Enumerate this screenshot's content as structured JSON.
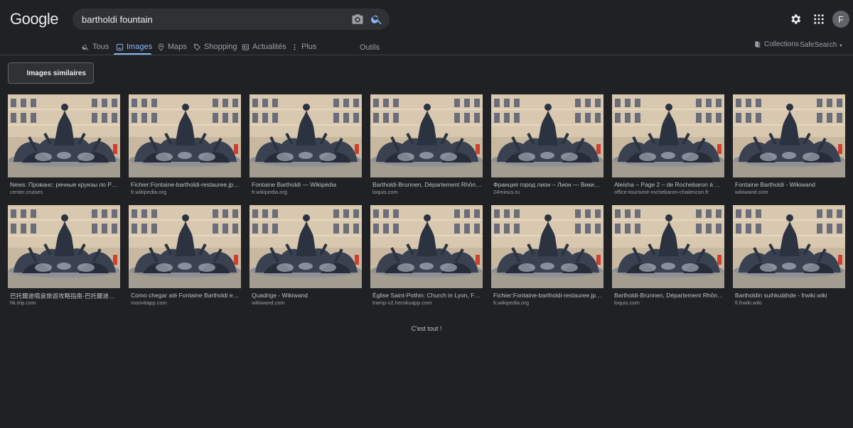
{
  "logo": {
    "text": "Google",
    "letters": [
      "G",
      "o",
      "o",
      "g",
      "l",
      "e"
    ],
    "colors": [
      "#8ab4f8",
      "#f28b82",
      "#fdd663",
      "#8ab4f8",
      "#81c995",
      "#f28b82"
    ]
  },
  "search": {
    "query": "bartholdi fountain",
    "placeholder": ""
  },
  "header": {
    "avatar_letter": "F",
    "gear": "gear-icon",
    "apps": "apps-grid-icon"
  },
  "tabs": [
    {
      "label": "Tous",
      "icon": "search-icon"
    },
    {
      "label": "Images",
      "icon": "image-icon",
      "active": true
    },
    {
      "label": "Maps",
      "icon": "map-pin-icon"
    },
    {
      "label": "Shopping",
      "icon": "tag-icon"
    },
    {
      "label": "Actualités",
      "icon": "news-icon"
    },
    {
      "label": "Plus",
      "icon": "more-vert-icon"
    },
    {
      "label": "Outils",
      "icon": ""
    }
  ],
  "right_links": {
    "collections": "Collections",
    "safesearch": "SafeSearch"
  },
  "similar_button": "Images similaires",
  "results": [
    {
      "title": "News: Прованс: речные круизы по Рон…",
      "source": "center.cruises"
    },
    {
      "title": "Fichier:Fontaine-bartholdi-restauree.jpg …",
      "source": "fr.wikipedia.org"
    },
    {
      "title": "Fontaine Bartholdi — Wikipédia",
      "source": "fr.wikipedia.org"
    },
    {
      "title": "Bartholdi-Brunnen, Département Rhône P…",
      "source": "loquis.com"
    },
    {
      "title": "Франция город лион – Лион — Википе…",
      "source": "24minus.ru"
    },
    {
      "title": "Aleisha – Page 2 – de Rochebaron à Cha…",
      "source": "office-tourisme-rochebaron-chalencon.fr"
    },
    {
      "title": "Fontaine Bartholdi - Wikiwand",
      "source": "wikiwand.com"
    },
    {
      "title": "巴托爾迪噴泉旅遊攻略指南-巴托爾迪噴泉…",
      "source": "hk.trip.com"
    },
    {
      "title": "Como chegar até Fontaine Bartholdi em …",
      "source": "moovitapp.com"
    },
    {
      "title": "Quadrige - Wikiwand",
      "source": "wikiwand.com"
    },
    {
      "title": "Église Saint-Pothin: Church in Lyon, France",
      "source": "tramp-v2.herokuapp.com"
    },
    {
      "title": "Fichier:Fontaine-bartholdi-restauree.jpg …",
      "source": "fr.wikipedia.org"
    },
    {
      "title": "Bartholdi-Brunnen, Département Rhône P…",
      "source": "loquis.com"
    },
    {
      "title": "Bartholdin suihkulähde - frwiki.wiki",
      "source": "fi.frwiki.wiki"
    }
  ],
  "end_text": "C'est tout !"
}
